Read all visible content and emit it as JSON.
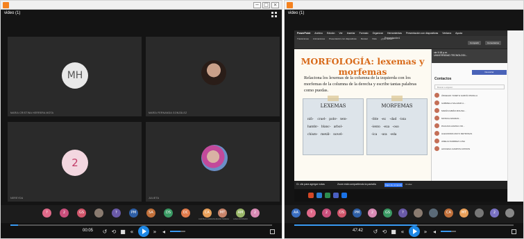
{
  "left": {
    "title": "video (1)",
    "tiles": [
      {
        "initials": "MH",
        "name": "MARIA CRISTINA HERRERA MOTA"
      },
      {
        "initials": "",
        "name": "MARÍA FERNANDA GONZÁLEZ"
      },
      {
        "initials": "2",
        "name": "NEREYDA"
      },
      {
        "initials": "",
        "name": "JULIETA"
      }
    ],
    "thumbs": [
      {
        "initials": "?",
        "color": "#e06a8a",
        "label": ""
      },
      {
        "initials": "2",
        "color": "#c94f7c",
        "label": ""
      },
      {
        "initials": "GS",
        "color": "#d1566b",
        "label": ""
      },
      {
        "initials": "",
        "color": "#8a7b70",
        "label": ""
      },
      {
        "initials": "?",
        "color": "#6a5aa8",
        "label": ""
      },
      {
        "initials": "PM",
        "color": "#2e5fa6",
        "label": ""
      },
      {
        "initials": "SA",
        "color": "#c1703a",
        "label": ""
      },
      {
        "initials": "DS",
        "color": "#3a9a64",
        "label": ""
      },
      {
        "initials": "DC",
        "color": "#e07b4c",
        "label": ""
      },
      {
        "initials": "CA",
        "color": "#e9a05a",
        "label": "CASTILLO ADRIANA"
      },
      {
        "initials": "MT",
        "color": "#c8846a",
        "label": "MARIA TERESA"
      },
      {
        "initials": "AM",
        "color": "#9bb86a",
        "label": "ALMA MONTERO"
      },
      {
        "initials": "2",
        "color": "#d88ab4",
        "label": ""
      }
    ],
    "time": "00:05"
  },
  "right": {
    "title": "video (1)",
    "ppt_menu": [
      "PowerPoint",
      "Archivo",
      "Edición",
      "Ver",
      "Insertar",
      "Formato",
      "Organizar",
      "Herramientas",
      "Presentación con diapositivas",
      "Ventana",
      "Ayuda"
    ],
    "ppt_doc": "Presentación1",
    "ppt_tabs": [
      "Transiciones",
      "Animaciones",
      "Presentación con diapositivas",
      "Revisar",
      "Vista",
      "¿Qué desea?"
    ],
    "compartir": "Compartir",
    "comentarios": "Comentarios",
    "slide": {
      "title": "MORFOLOGÍA: lexemas y morfemas",
      "instruction": "Relaciona los lexemas de la columna de la izquierda con los morfemas de la columna de la derecha y escribe tantas palabras como puedas.",
      "lexemas_label": "LEXEMAS",
      "lexemas_words": "niñ-    cruel-   pobr-   tem-\nhambr-   blanc-   arbol-\nchism-   metál-   novel-",
      "morfemas_label": "MORFEMAS",
      "morfemas_words": "-ible   -ez    -dad   -ista\n-iento   -eza   -oso\n-ica    -ura   -eda"
    },
    "panel": {
      "clock": "vie 9:18 p.m.",
      "org": "UNIVERSIDAD TECNOLOGI...",
      "button": "Descartar",
      "header": "Contactos",
      "search": "Buscar a alguien",
      "contacts": [
        "ÁNGELES YANETH GARCÍA PADILLA",
        "GABRIELA SALAZAR A...",
        "MARÍA FABIÁN MOLINA...",
        "MONICA AMARAN...",
        "PAULINA GAVIDIA VID...",
        "ALEJANDRA MAYO RETROSAS",
        "AMELIA RAMIREZ LUNA",
        "AZUCENA CAMPOS ASTRON"
      ]
    },
    "status": "Zoom está compartiendo la pantalla",
    "status_left": "Cl. clic para agregar notas",
    "stop_share": "Dejar de compartir",
    "hide": "Ocultar",
    "thumbs": [
      {
        "initials": "AA",
        "color": "#3a6ec0"
      },
      {
        "initials": "?",
        "color": "#e06a8a"
      },
      {
        "initials": "2",
        "color": "#c94f7c"
      },
      {
        "initials": "DS",
        "color": "#d1566b"
      },
      {
        "initials": "PM",
        "color": "#2e5fa6"
      },
      {
        "initials": "2",
        "color": "#d88ab4"
      },
      {
        "initials": "GS",
        "color": "#3a9a64"
      },
      {
        "initials": "?",
        "color": "#6a5aa8"
      },
      {
        "initials": "",
        "color": "#8a7b70"
      },
      {
        "initials": "",
        "color": "#5a6a78"
      },
      {
        "initials": "CA",
        "color": "#c1703a"
      },
      {
        "initials": "MT",
        "color": "#e9a05a"
      },
      {
        "initials": "",
        "color": "#777"
      },
      {
        "initials": "2",
        "color": "#7a72c4"
      },
      {
        "initials": "",
        "color": "#888"
      }
    ],
    "time": "47:42"
  },
  "left_progress": 0.03,
  "right_progress": 0.56
}
